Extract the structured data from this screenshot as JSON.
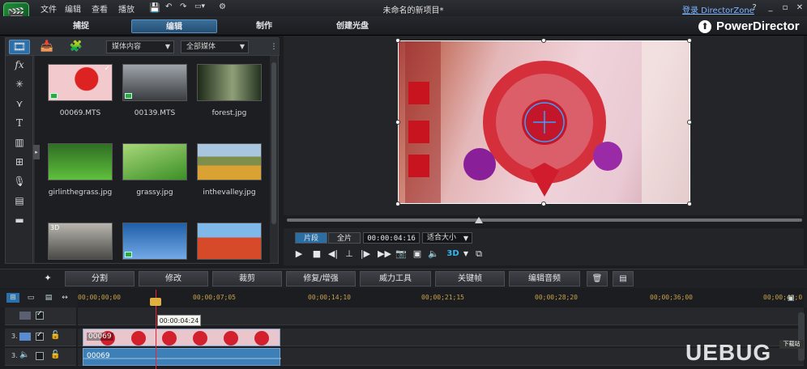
{
  "app": {
    "menu": [
      "文件",
      "编辑",
      "查看",
      "播放"
    ],
    "window_title": "未命名的新项目*",
    "directorzone": "登录 DirectorZone",
    "brand": "PowerDirector"
  },
  "modes": [
    "捕捉",
    "编辑",
    "制作",
    "创建光盘"
  ],
  "library": {
    "filter_content": "媒体内容",
    "filter_media": "全部媒体",
    "items": [
      {
        "name": "00069.MTS",
        "bg": "#c45a5a",
        "badge": true
      },
      {
        "name": "00139.MTS",
        "bg": "#8a8d91",
        "badge": true
      },
      {
        "name": "forest.jpg",
        "bg": "#4f6a3a",
        "badge": false
      },
      {
        "name": "girlinthegrass.jpg",
        "bg": "#3e9a2e",
        "badge": false
      },
      {
        "name": "grassy.jpg",
        "bg": "#6fb037",
        "badge": false
      },
      {
        "name": "inthevalley.jpg",
        "bg": "#c7a44a",
        "badge": false
      },
      {
        "name": "",
        "bg": "#8d8a82",
        "badge": false,
        "label": "3D"
      },
      {
        "name": "",
        "bg": "#2e6fb8",
        "badge": true
      },
      {
        "name": "",
        "bg": "#4c9bdc",
        "badge": false
      }
    ]
  },
  "preview": {
    "seg_clip": "片段",
    "seg_movie": "全片",
    "timecode": "00:00:04:16",
    "fit": "适合大小",
    "three_d": "3D"
  },
  "edit_buttons": [
    "分割",
    "修改",
    "裁剪",
    "修复/增强",
    "威力工具",
    "关键帧",
    "编辑音频"
  ],
  "timeline": {
    "ruler": [
      "00;00;00;00",
      "00;00;07;05",
      "00;00;14;10",
      "00;00;21;15",
      "00;00;28;20",
      "00;00;36;00",
      "00;00;43;0"
    ],
    "cursor_tip": "00:00:04:24",
    "video_clip": "00069",
    "audio_clip": "00069",
    "track_num_v": "3.",
    "track_num_a": "3."
  },
  "watermark": {
    "text": "UEBUG",
    "tag": "下载站"
  }
}
